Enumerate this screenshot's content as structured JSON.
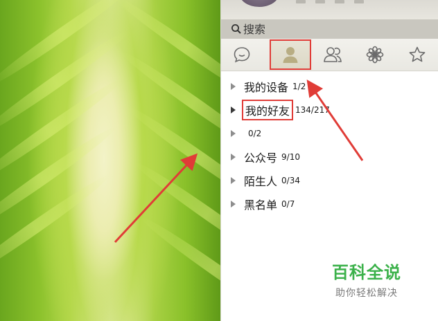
{
  "search": {
    "placeholder": "搜索"
  },
  "tabs": [
    {
      "icon": "chat-bubble-icon",
      "selected": false
    },
    {
      "icon": "contact-person-icon",
      "selected": true
    },
    {
      "icon": "groups-icon",
      "selected": false
    },
    {
      "icon": "flower-icon",
      "selected": false
    },
    {
      "icon": "star-icon",
      "selected": false
    }
  ],
  "groups": [
    {
      "name": "我的设备",
      "count": "1/2"
    },
    {
      "name": "我的好友",
      "count": "134/217"
    },
    {
      "name": "",
      "count": "0/2"
    },
    {
      "name": "公众号",
      "count": "9/10"
    },
    {
      "name": "陌生人",
      "count": "0/34"
    },
    {
      "name": "黑名单",
      "count": "0/7"
    }
  ],
  "watermark": {
    "title": "百科全说",
    "subtitle": "助你轻松解决"
  },
  "colors": {
    "highlight": "#e03c37",
    "brand_green": "#3bb14a",
    "search_bar": "#c9c7bf"
  }
}
